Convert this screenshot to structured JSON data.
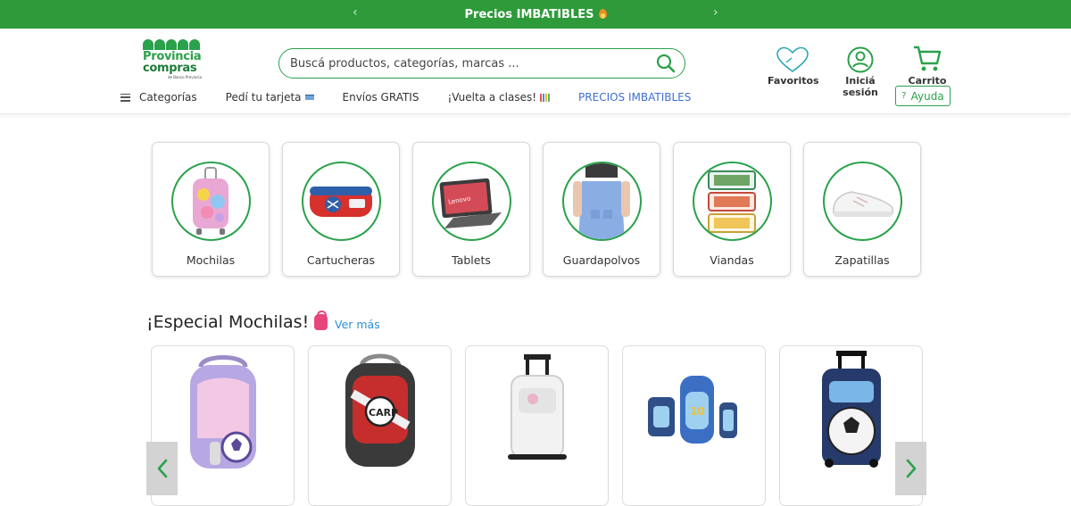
{
  "promo_bar": {
    "text": "Precios IMBATIBLES",
    "prev_arrow": "‹",
    "next_arrow": "›",
    "bg_color": "#2e9a3a"
  },
  "logo": {
    "line1": "Provincia",
    "line2": "compras",
    "sub": "de Banco Provincia"
  },
  "search": {
    "placeholder": "Buscá productos, categorías, marcas ..."
  },
  "header_actions": {
    "favorites": "Favoritos",
    "login": "Iniciá sesión",
    "cart": "Carrito",
    "help": "Ayuda"
  },
  "nav": {
    "categories": "Categorías",
    "card": "Pedí tu tarjeta",
    "shipping": "Envíos GRATIS",
    "back_to_school": "¡Vuelta a clases!",
    "promo": "PRECIOS IMBATIBLES"
  },
  "categories": [
    {
      "label": "Mochilas",
      "icon": "backpack-icon"
    },
    {
      "label": "Cartucheras",
      "icon": "pencil-case-icon"
    },
    {
      "label": "Tablets",
      "icon": "tablet-icon"
    },
    {
      "label": "Guardapolvos",
      "icon": "apron-icon"
    },
    {
      "label": "Viandas",
      "icon": "lunchbox-icon"
    },
    {
      "label": "Zapatillas",
      "icon": "sneaker-icon"
    }
  ],
  "special": {
    "title": "¡Especial Mochilas!",
    "see_more": "Ver más"
  },
  "products": [
    {
      "name": "mochila-unicornio",
      "icon": "backpack-icon"
    },
    {
      "name": "mochila-river-plate",
      "icon": "backpack-icon"
    },
    {
      "name": "mochila-carro-blanca",
      "icon": "trolley-backpack-icon"
    },
    {
      "name": "set-mochila-messi",
      "icon": "backpack-set-icon"
    },
    {
      "name": "mochila-carro-futbol",
      "icon": "trolley-backpack-icon"
    }
  ],
  "colors": {
    "brand_green": "#2aa14a",
    "link_blue": "#2a8fd8",
    "promo_purple": "#3f6fd1"
  }
}
